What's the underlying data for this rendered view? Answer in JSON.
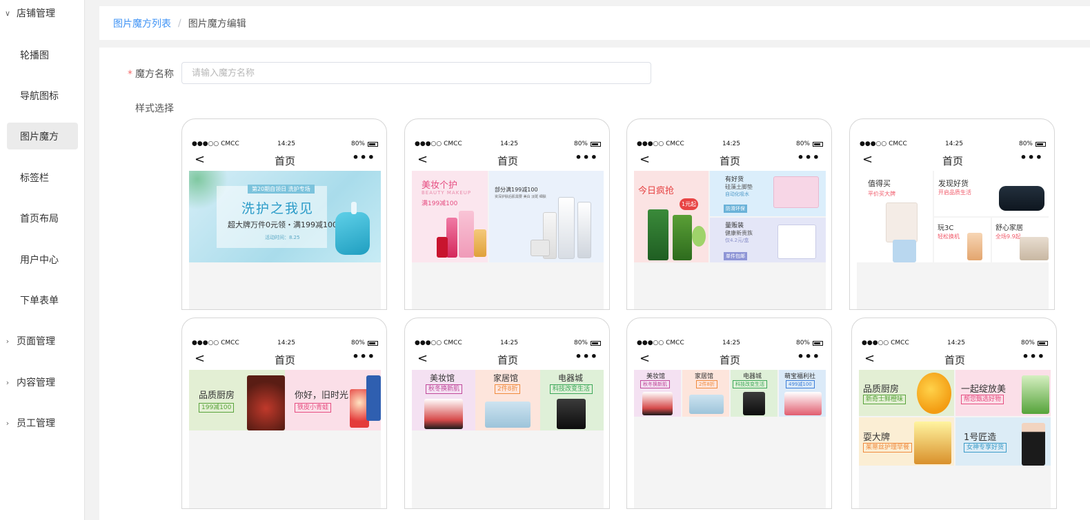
{
  "sidebar": {
    "groups": [
      {
        "label": "店铺管理",
        "expanded": true
      },
      {
        "label": "页面管理",
        "expanded": false
      },
      {
        "label": "内容管理",
        "expanded": false
      },
      {
        "label": "员工管理",
        "expanded": false
      }
    ],
    "items": [
      {
        "label": "轮播图"
      },
      {
        "label": "导航图标"
      },
      {
        "label": "图片魔方",
        "active": true
      },
      {
        "label": "标签栏"
      },
      {
        "label": "首页布局"
      },
      {
        "label": "用户中心"
      },
      {
        "label": "下单表单"
      }
    ]
  },
  "breadcrumb": {
    "parent": "图片魔方列表",
    "separator": "/",
    "current": "图片魔方编辑"
  },
  "form": {
    "name_label": "魔方名称",
    "required_mark": "*",
    "name_placeholder": "请输入魔方名称",
    "name_value": "",
    "style_label": "样式选择"
  },
  "phone": {
    "carrier": "●●●○○ CMCC",
    "wifi": "wifi-icon",
    "time": "14:25",
    "battery": "80%",
    "title": "首页",
    "back": "<",
    "more": "•••"
  },
  "styles": [
    {
      "s1": {
        "title": "第20期自领日 洗护专场",
        "headline": "洗护之我见",
        "sub": "超大牌万件0元领・满199减100",
        "date": "活动时间：8.25"
      }
    },
    {
      "left": {
        "title": "美妆个护",
        "en": "BEAUTY MAKEUP",
        "sub": "满199减100"
      },
      "right": {
        "title": "部分满199减100",
        "sub": "资深护肤后肌需要 美白 淡斑 细肤"
      }
    },
    {
      "left": {
        "title": "今日疯抢",
        "badge": "1元起"
      },
      "rt": {
        "title": "有好货",
        "sub": "硅藻土脚垫",
        "sub2": "自动化吸水",
        "tag": "防滑环保"
      },
      "rb": {
        "title": "量贩装",
        "sub": "健康新贵族",
        "sub2": "仅4.2元/盒",
        "tag": "单件包邮"
      }
    },
    {
      "left": {
        "title": "值得买",
        "sub": "平价买大牌"
      },
      "rt": {
        "title": "发现好货",
        "sub": "开启品质生活"
      },
      "rb1": {
        "title": "玩3C",
        "sub": "轻松换机"
      },
      "rb2": {
        "title": "舒心家居",
        "sub": "全场9.9起"
      }
    },
    {
      "left": {
        "title": "品质厨房",
        "tag": "199减100"
      },
      "right": {
        "title": "你好，旧时光",
        "tag": "铁皮小青蛙"
      }
    },
    {
      "a": {
        "title": "美妆馆",
        "tag": "秋冬换新肌"
      },
      "b": {
        "title": "家居馆",
        "tag": "2件8折"
      },
      "c": {
        "title": "电器城",
        "tag": "科技改变生活"
      }
    },
    {
      "a": {
        "title": "美妆馆",
        "tag": "秋冬换新肌"
      },
      "b": {
        "title": "家居馆",
        "tag": "2件8折"
      },
      "c": {
        "title": "电器城",
        "tag": "科技改变生活"
      },
      "d": {
        "title": "萌宝福利社",
        "tag": "499减100"
      }
    },
    {
      "tl": {
        "title": "品质厨房",
        "tag": "新奇士鲜橙味"
      },
      "tr": {
        "title": "一起绽放美",
        "tag": "帮您甄选好物"
      },
      "bl": {
        "title": "耍大牌",
        "tag": "茱蒂丝护理早餐"
      },
      "br": {
        "title": "1号匠造",
        "tag": "女神专享好货"
      }
    }
  ],
  "colors": {
    "primary": "#3f93f5",
    "required": "#f56c6c",
    "pink": "#e64c80",
    "green": "#3aa757",
    "blue": "#3b7dd8",
    "orange": "#f08a3c"
  }
}
